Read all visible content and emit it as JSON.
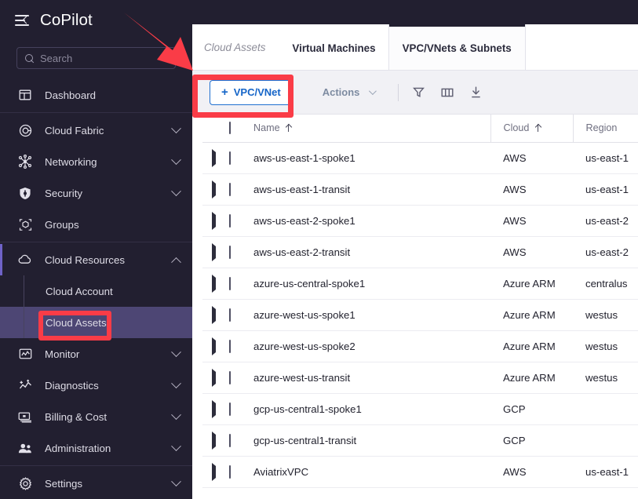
{
  "app": {
    "brand": "CoPilot",
    "menu_icon": "hamburger-collapse-icon"
  },
  "sidebar": {
    "search": {
      "placeholder": "Search",
      "value": "",
      "icon": "search-icon"
    },
    "items": [
      {
        "label": "Dashboard",
        "icon": "dashboard-icon",
        "expandable": false,
        "expanded": false
      },
      {
        "label": "Cloud Fabric",
        "icon": "target-icon",
        "expandable": true,
        "expanded": false
      },
      {
        "label": "Networking",
        "icon": "network-nodes-icon",
        "expandable": true,
        "expanded": false
      },
      {
        "label": "Security",
        "icon": "shield-icon",
        "expandable": true,
        "expanded": false
      },
      {
        "label": "Groups",
        "icon": "cube-group-icon",
        "expandable": false,
        "expanded": false
      },
      {
        "label": "Cloud Resources",
        "icon": "cloud-icon",
        "expandable": true,
        "expanded": true
      },
      {
        "label": "Monitor",
        "icon": "monitor-chart-icon",
        "expandable": true,
        "expanded": false
      },
      {
        "label": "Diagnostics",
        "icon": "diagnostics-icon",
        "expandable": true,
        "expanded": false
      },
      {
        "label": "Billing & Cost",
        "icon": "billing-icon",
        "expandable": true,
        "expanded": false
      },
      {
        "label": "Administration",
        "icon": "users-icon",
        "expandable": true,
        "expanded": false
      },
      {
        "label": "Settings",
        "icon": "gear-icon",
        "expandable": true,
        "expanded": false
      }
    ],
    "cloud_resources_children": [
      {
        "label": "Cloud Account",
        "active": false
      },
      {
        "label": "Cloud Assets",
        "active": true
      }
    ]
  },
  "content": {
    "breadcrumb": "Cloud Assets",
    "tabs": [
      {
        "label": "Virtual Machines",
        "active": false
      },
      {
        "label": "VPC/VNets & Subnets",
        "active": true
      }
    ],
    "toolbar": {
      "create_label": "VPC/VNet",
      "create_plus": "+",
      "actions_label": "Actions",
      "icons": [
        {
          "name": "filter-icon"
        },
        {
          "name": "columns-icon"
        },
        {
          "name": "download-icon"
        }
      ]
    },
    "table": {
      "columns": [
        {
          "key": "name",
          "label": "Name",
          "sorted": true,
          "sort_dir": "asc"
        },
        {
          "key": "cloud",
          "label": "Cloud",
          "sorted": true,
          "sort_dir": "asc"
        },
        {
          "key": "region",
          "label": "Region",
          "sorted": false,
          "sort_dir": ""
        }
      ],
      "rows": [
        {
          "name": "aws-us-east-1-spoke1",
          "cloud": "AWS",
          "region": "us-east-1"
        },
        {
          "name": "aws-us-east-1-transit",
          "cloud": "AWS",
          "region": "us-east-1"
        },
        {
          "name": "aws-us-east-2-spoke1",
          "cloud": "AWS",
          "region": "us-east-2"
        },
        {
          "name": "aws-us-east-2-transit",
          "cloud": "AWS",
          "region": "us-east-2"
        },
        {
          "name": "azure-us-central-spoke1",
          "cloud": "Azure ARM",
          "region": "centralus"
        },
        {
          "name": "azure-west-us-spoke1",
          "cloud": "Azure ARM",
          "region": "westus"
        },
        {
          "name": "azure-west-us-spoke2",
          "cloud": "Azure ARM",
          "region": "westus"
        },
        {
          "name": "azure-west-us-transit",
          "cloud": "Azure ARM",
          "region": "westus"
        },
        {
          "name": "gcp-us-central1-spoke1",
          "cloud": "GCP",
          "region": ""
        },
        {
          "name": "gcp-us-central1-transit",
          "cloud": "GCP",
          "region": ""
        },
        {
          "name": "AviatrixVPC",
          "cloud": "AWS",
          "region": "us-east-1"
        }
      ]
    }
  },
  "annotations": {
    "arrow": {
      "name": "red-pointer-arrow",
      "color": "#fa3c47"
    },
    "highlight_boxes": [
      {
        "name": "cloud-assets-highlight",
        "color": "#fa3c47"
      },
      {
        "name": "add-vpc-highlight",
        "color": "#fa3c47"
      }
    ]
  },
  "colors": {
    "sidebar_bg": "#221f30",
    "sidebar_active": "#4d4674",
    "accent_purple": "#6f62c7",
    "link_blue": "#1565c8",
    "annotation_red": "#fa3c47"
  }
}
